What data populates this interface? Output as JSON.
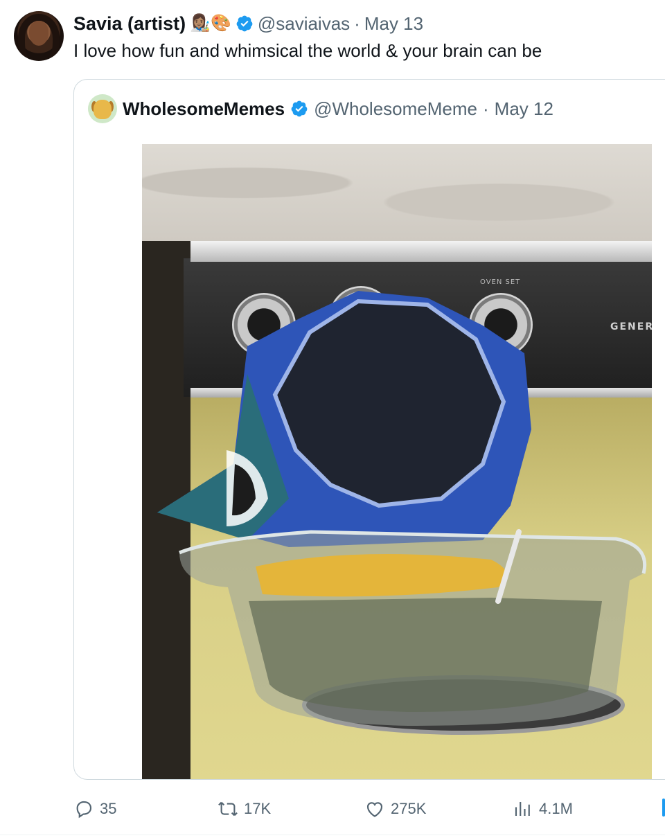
{
  "tweet": {
    "author_name": "Savia (artist)",
    "author_emojis": "👩🏽‍🎨🎨",
    "handle": "@saviaivas",
    "separator": "·",
    "date": "May 13",
    "text": "I love how fun and whimsical the world & your brain can be"
  },
  "quote": {
    "author_name": "WholesomeMemes",
    "handle": "@WholesomeMeme",
    "separator": "·",
    "date": "May 12",
    "media": {
      "oven_label": "OVEN SET",
      "brand_text": "GENER"
    }
  },
  "stats": {
    "replies": "35",
    "reposts": "17K",
    "likes": "275K",
    "views": "4.1M"
  },
  "colors": {
    "verified": "#1d9bf0",
    "secondary_text": "#536471",
    "border": "#cfd9de"
  }
}
